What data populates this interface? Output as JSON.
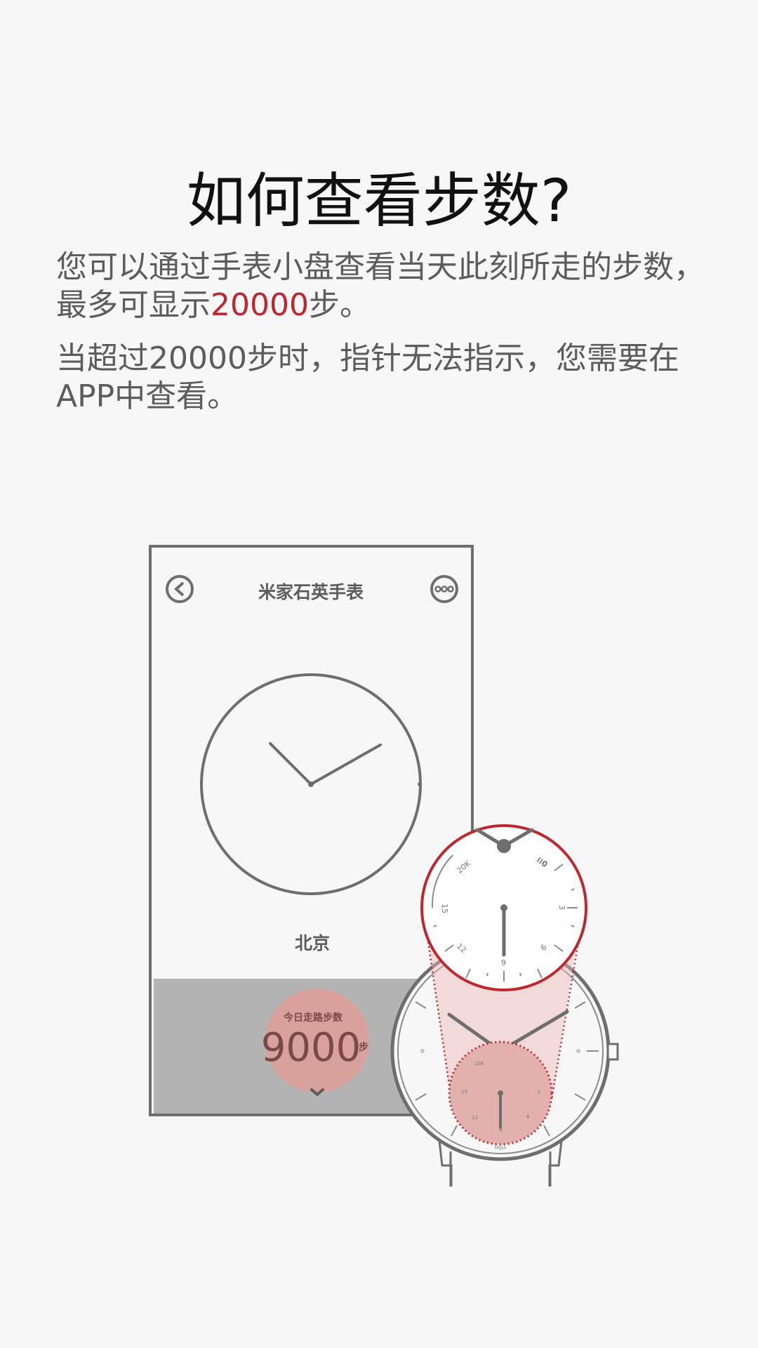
{
  "title": "如何查看步数?",
  "intro": {
    "before_number": "您可以通过手表小盘查看当天此刻所走的步数，最多可显示",
    "highlight_number": "20000",
    "after_number": "步。"
  },
  "note": "当超过20000步时，指针无法指示，您需要在APP中查看。",
  "phone": {
    "app_title": "米家石英手表",
    "back_icon": "back-chevron-icon",
    "more_icon": "more-dots-icon",
    "city": "北京",
    "steps_label": "今日走路步数",
    "steps_value": "9000",
    "steps_unit": "步"
  },
  "watch": {
    "subdial_labels": [
      "20K",
      "15",
      "12",
      "9",
      "6",
      "3"
    ],
    "brand": "MIJIA"
  },
  "colors": {
    "accent": "#c0262d",
    "line": "#6e6e6e",
    "background": "#f7f7f7",
    "phone_bottom": "#b3b3b3",
    "steps_circle": "#d9a19c"
  }
}
